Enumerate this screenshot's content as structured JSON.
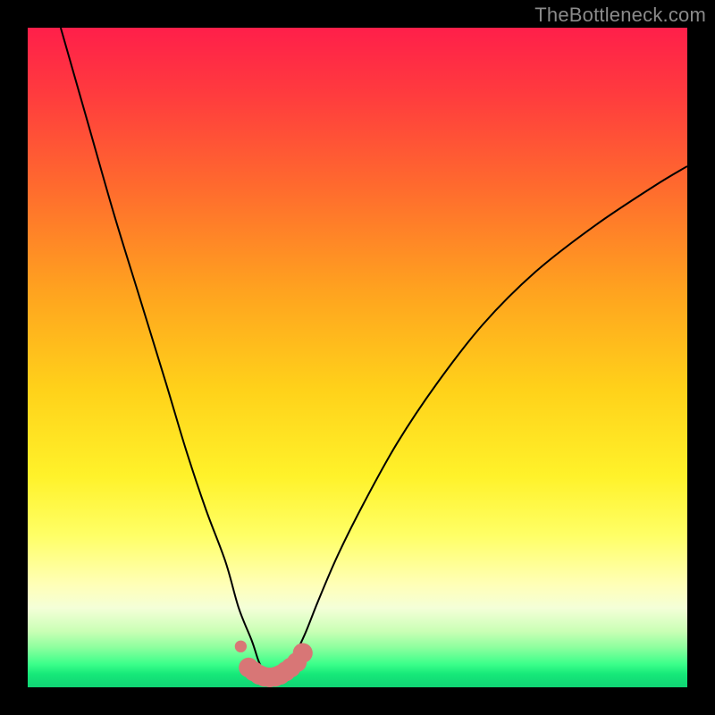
{
  "watermark": {
    "text": "TheBottleneck.com"
  },
  "colors": {
    "frame": "#000000",
    "curve": "#000000",
    "dots": "#d87676",
    "watermark": "#8a8a8a"
  },
  "chart_data": {
    "type": "line",
    "title": "",
    "xlabel": "",
    "ylabel": "",
    "xlim": [
      0,
      100
    ],
    "ylim": [
      0,
      100
    ],
    "grid": false,
    "series": [
      {
        "name": "bottleneck-curve",
        "x": [
          5,
          9,
          13,
          17,
          21,
          24,
          27,
          30,
          32,
          34,
          35,
          36,
          37,
          38,
          40,
          42,
          44,
          47,
          51,
          56,
          62,
          69,
          77,
          86,
          95,
          100
        ],
        "y": [
          100,
          86,
          72,
          59,
          46,
          36,
          27,
          19,
          12,
          7,
          4,
          2,
          1,
          2,
          4,
          8,
          13,
          20,
          28,
          37,
          46,
          55,
          63,
          70,
          76,
          79
        ]
      }
    ],
    "highlight_dots": {
      "name": "optimal-range",
      "x": [
        32.3,
        33.5,
        34.3,
        35.1,
        35.9,
        36.7,
        37.5,
        38.3,
        39.1,
        39.9,
        40.8,
        41.7
      ],
      "y": [
        6.2,
        3.0,
        2.4,
        1.9,
        1.6,
        1.5,
        1.6,
        1.9,
        2.4,
        3.0,
        3.8,
        5.2
      ]
    },
    "background_gradient": {
      "orientation": "vertical",
      "stops": [
        {
          "pos": 0.0,
          "color": "#ff1f4a"
        },
        {
          "pos": 0.55,
          "color": "#ffd21a"
        },
        {
          "pos": 0.85,
          "color": "#ffffb8"
        },
        {
          "pos": 1.0,
          "color": "#10d474"
        }
      ]
    }
  }
}
